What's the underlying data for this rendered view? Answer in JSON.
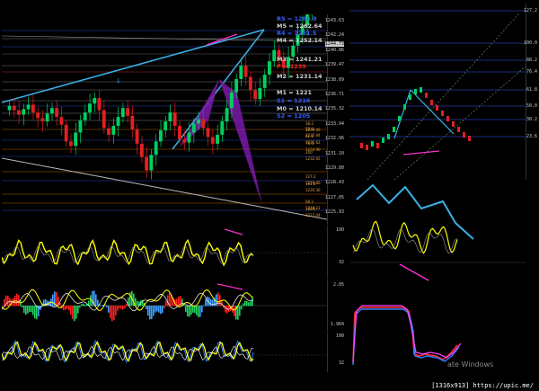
{
  "left_axis_ticks": [
    "1243.63",
    "1242.24",
    "1240.86",
    "1239.47",
    "1238.09",
    "1236.71",
    "1235.32",
    "1233.94",
    "1232.96",
    "1231.10",
    "1229.80",
    "1228.43",
    "1227.05",
    "1225.93"
  ],
  "last_price": "1244.73",
  "osc1_ticks": [
    "100",
    "32"
  ],
  "osc2_ticks": [
    "2.05",
    "1.964"
  ],
  "osc3_ticks": [
    "100",
    "32"
  ],
  "levels": [
    {
      "label": "R5 = 1280.8",
      "color": "#3b5bff"
    },
    {
      "label": "M5 = 1262.64",
      "color": "#cfcfcf"
    },
    {
      "label": "R4 = 1261.5",
      "color": "#3b5bff"
    },
    {
      "label": "M4 = 1252.14",
      "color": "#cfcfcf"
    },
    {
      "label": "M3 = 1241.21",
      "color": "#cfcfcf"
    },
    {
      "label": "P = 1239",
      "color": "#ff2020"
    },
    {
      "label": "M2 = 1231.14",
      "color": "#cfcfcf"
    },
    {
      "label": "M1 = 1221",
      "color": "#cfcfcf"
    },
    {
      "label": "S1 = 1216",
      "color": "#3b5bff"
    },
    {
      "label": "M0 = 1210.14",
      "color": "#cfcfcf"
    },
    {
      "label": "S2 = 1205",
      "color": "#3b5bff"
    }
  ],
  "fib_labels": [
    "38.2 1239.06",
    "50.0 1237.84",
    "61.8 1236.62",
    "78.6 1234.90",
    "100 1232.65",
    "127.2 1229.86",
    "161.8 1226.30",
    "88.2 1228.22",
    "100.0 1227.04"
  ],
  "right_ticks": [
    "127.2",
    "100.0",
    "88.2",
    "76.4",
    "61.8",
    "50.0",
    "38.2",
    "23.6"
  ],
  "watermark": "[1316x913] https://upic.me/",
  "windows_text": "ate Windows",
  "chart_data": {
    "type": "candlestick",
    "title": "",
    "series": [
      {
        "values": [
          1236.2,
          1235.8,
          1235.4,
          1235.9,
          1236.3,
          1235.6,
          1235.1,
          1234.8,
          1235.5,
          1236.0,
          1235.2,
          1234.5,
          1233.0,
          1232.6,
          1233.8,
          1234.9,
          1235.6,
          1236.4,
          1236.9,
          1235.8,
          1234.2,
          1233.6,
          1234.4,
          1235.2,
          1236.0,
          1235.3,
          1234.1,
          1232.8,
          1231.6,
          1230.4,
          1231.8,
          1233.0,
          1234.0,
          1234.8,
          1235.6,
          1234.4,
          1233.2,
          1232.9,
          1233.8,
          1234.6,
          1235.0,
          1234.2,
          1233.4,
          1232.8,
          1233.6,
          1234.8,
          1236.0,
          1237.4,
          1238.6,
          1239.8,
          1238.8,
          1237.6,
          1236.8,
          1237.8,
          1239.0,
          1240.2,
          1241.2,
          1240.4,
          1239.6,
          1240.6,
          1241.6,
          1242.6,
          1243.4,
          1244.4,
          1244.73
        ]
      }
    ],
    "ylim": [
      1225.93,
      1244.0
    ]
  }
}
